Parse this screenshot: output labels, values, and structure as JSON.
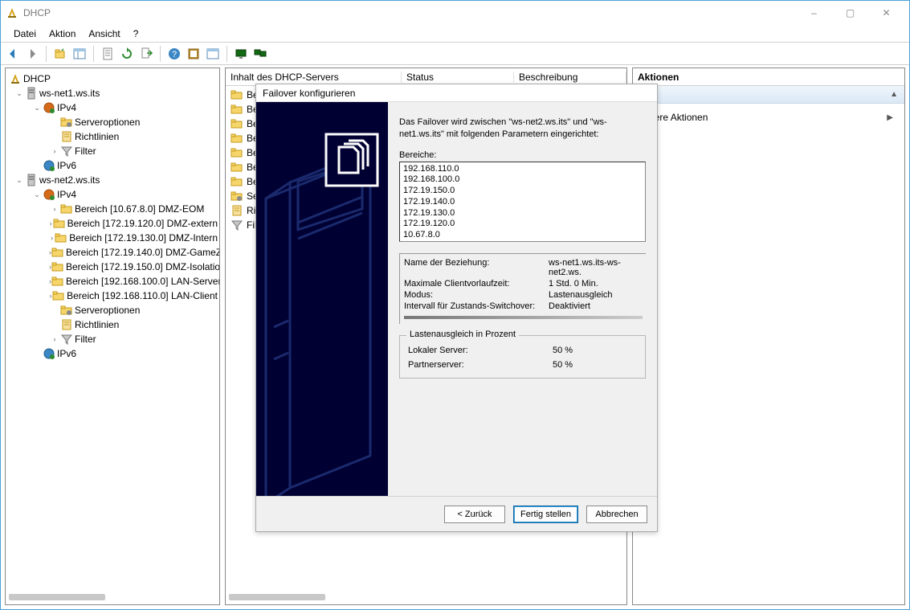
{
  "window": {
    "title": "DHCP",
    "min": "–",
    "max": "▢",
    "close": "✕"
  },
  "menu": [
    "Datei",
    "Aktion",
    "Ansicht",
    "?"
  ],
  "tree": {
    "root": "DHCP",
    "nodes": [
      {
        "expander": "⌄",
        "indent": 0,
        "icon": "server-icon",
        "label": "ws-net1.ws.its"
      },
      {
        "expander": "⌄",
        "indent": 1,
        "icon": "ipv4-icon",
        "label": "IPv4"
      },
      {
        "expander": "",
        "indent": 2,
        "icon": "folder-cog-icon",
        "label": "Serveroptionen"
      },
      {
        "expander": "",
        "indent": 2,
        "icon": "policy-icon",
        "label": "Richtlinien"
      },
      {
        "expander": "›",
        "indent": 2,
        "icon": "filter-icon",
        "label": "Filter"
      },
      {
        "expander": "",
        "indent": 1,
        "icon": "ipv6-icon",
        "label": "IPv6"
      },
      {
        "expander": "⌄",
        "indent": 0,
        "icon": "server-icon",
        "label": "ws-net2.ws.its"
      },
      {
        "expander": "⌄",
        "indent": 1,
        "icon": "ipv4-icon",
        "label": "IPv4"
      },
      {
        "expander": "›",
        "indent": 2,
        "icon": "scope-icon",
        "label": "Bereich [10.67.8.0] DMZ-EOM"
      },
      {
        "expander": "›",
        "indent": 2,
        "icon": "scope-icon",
        "label": "Bereich [172.19.120.0] DMZ-extern"
      },
      {
        "expander": "›",
        "indent": 2,
        "icon": "scope-icon",
        "label": "Bereich [172.19.130.0] DMZ-Intern"
      },
      {
        "expander": "›",
        "indent": 2,
        "icon": "scope-icon",
        "label": "Bereich [172.19.140.0] DMZ-GameZ"
      },
      {
        "expander": "›",
        "indent": 2,
        "icon": "scope-icon",
        "label": "Bereich [172.19.150.0] DMZ-Isolatio"
      },
      {
        "expander": "›",
        "indent": 2,
        "icon": "scope-icon",
        "label": "Bereich [192.168.100.0] LAN-Server"
      },
      {
        "expander": "›",
        "indent": 2,
        "icon": "scope-icon",
        "label": "Bereich [192.168.110.0] LAN-Client"
      },
      {
        "expander": "",
        "indent": 2,
        "icon": "folder-cog-icon",
        "label": "Serveroptionen"
      },
      {
        "expander": "",
        "indent": 2,
        "icon": "policy-icon",
        "label": "Richtlinien"
      },
      {
        "expander": "›",
        "indent": 2,
        "icon": "filter-icon",
        "label": "Filter"
      },
      {
        "expander": "",
        "indent": 1,
        "icon": "ipv6-icon",
        "label": "IPv6"
      }
    ]
  },
  "center": {
    "header": {
      "c1": "Inhalt des DHCP-Servers",
      "c2": "Status",
      "c3": "Beschreibung"
    },
    "rows": [
      {
        "icon": "scope-icon",
        "label": "Ber"
      },
      {
        "icon": "scope-icon",
        "label": "Ber"
      },
      {
        "icon": "scope-icon",
        "label": "Ber"
      },
      {
        "icon": "scope-icon",
        "label": "Ber"
      },
      {
        "icon": "scope-icon",
        "label": "Ber"
      },
      {
        "icon": "scope-icon",
        "label": "Ber"
      },
      {
        "icon": "scope-icon",
        "label": "Ber"
      },
      {
        "icon": "folder-cog-icon",
        "label": "Ser"
      },
      {
        "icon": "policy-icon",
        "label": "Ric"
      },
      {
        "icon": "filter-icon",
        "label": "Filt"
      }
    ]
  },
  "actions": {
    "header": "Aktionen",
    "sub": "",
    "item1": "eitere Aktionen"
  },
  "wizard": {
    "title": "Failover konfigurieren",
    "intro": "Das Failover wird zwischen \"ws-net2.ws.its\" und \"ws-net1.ws.its\" mit folgenden Parametern eingerichtet:",
    "scopes_label": "Bereiche:",
    "scopes": [
      "192.168.110.0",
      "192.168.100.0",
      "172.19.150.0",
      "172.19.140.0",
      "172.19.130.0",
      "172.19.120.0",
      "10.67.8.0"
    ],
    "details": {
      "rel_label": "Name der Beziehung:",
      "rel_value": "ws-net1.ws.its-ws-net2.ws.",
      "lead_label": "Maximale Clientvorlaufzeit:",
      "lead_value": "1 Std. 0 Min.",
      "mode_label": "Modus:",
      "mode_value": "Lastenausgleich",
      "switch_label": "Intervall für Zustands-Switchover:",
      "switch_value": "Deaktiviert"
    },
    "balance": {
      "legend": "Lastenausgleich in Prozent",
      "local_label": "Lokaler Server:",
      "local_value": "50 %",
      "partner_label": "Partnerserver:",
      "partner_value": "50 %"
    },
    "buttons": {
      "back": "< Zurück",
      "finish": "Fertig stellen",
      "cancel": "Abbrechen"
    }
  }
}
